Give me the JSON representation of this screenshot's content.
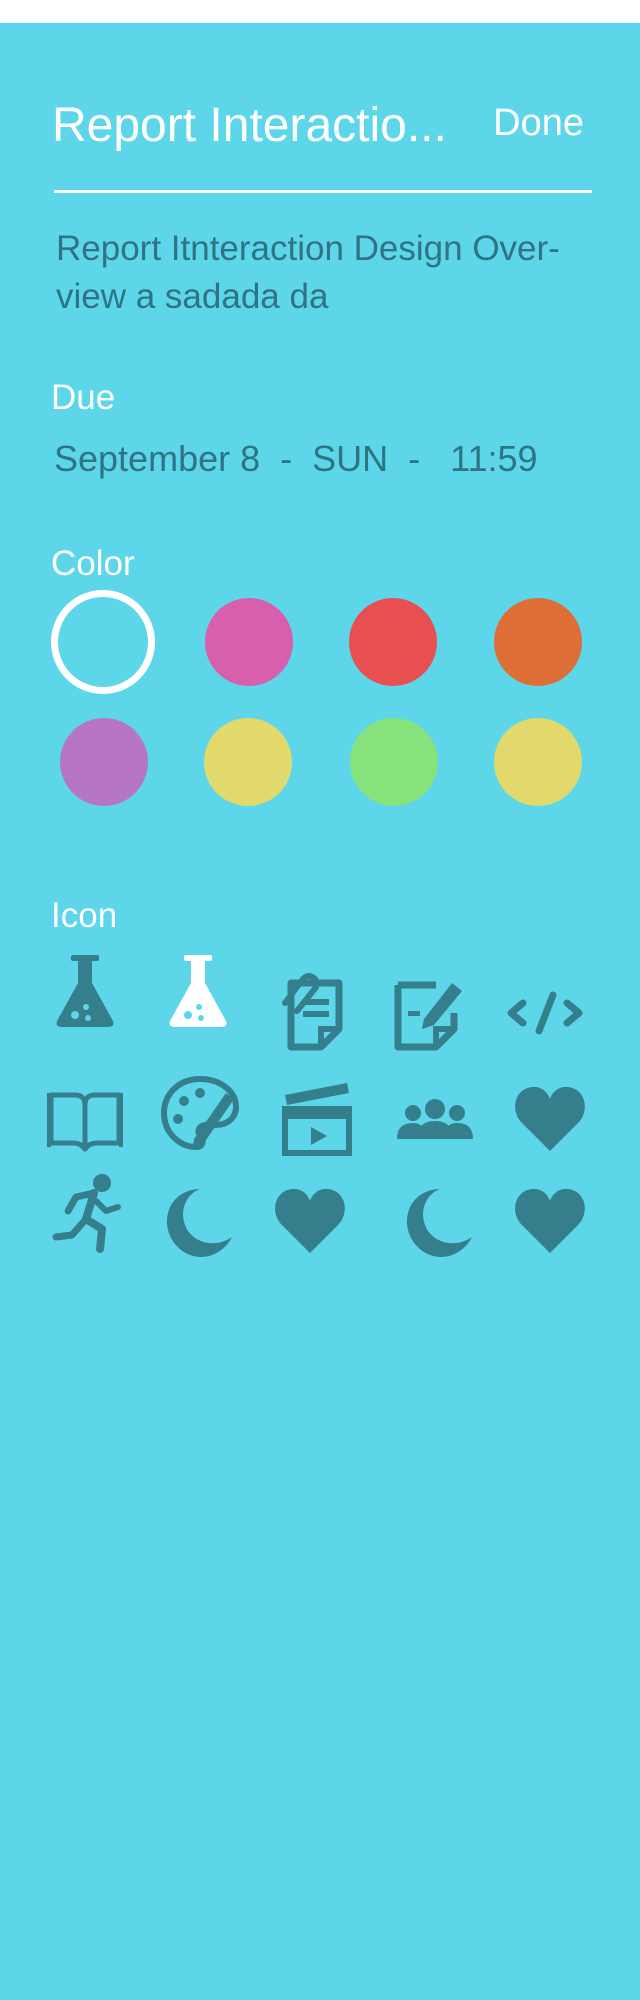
{
  "header": {
    "title": "Report Interactio...",
    "done_label": "Done"
  },
  "description": "Report Itnteraction Design Over-view a sadada  da",
  "due": {
    "label": "Due",
    "value": "September 8  -  SUN  -   11:59"
  },
  "color": {
    "label": "Color",
    "swatches": [
      {
        "name": "cyan-selected",
        "hex": "#5ed6ea",
        "selected": true
      },
      {
        "name": "pink",
        "hex": "#d85fad"
      },
      {
        "name": "red",
        "hex": "#e84f51"
      },
      {
        "name": "orange",
        "hex": "#dd6e36"
      },
      {
        "name": "purple",
        "hex": "#b775c8"
      },
      {
        "name": "yellow",
        "hex": "#e2d96d"
      },
      {
        "name": "green",
        "hex": "#86e27b"
      },
      {
        "name": "yellow-2",
        "hex": "#e2d96d"
      }
    ]
  },
  "icon": {
    "label": "Icon",
    "items": [
      "flask",
      "flask-selected",
      "clipboard-attach",
      "edit-note",
      "code",
      "open-book",
      "palette",
      "clapperboard",
      "group",
      "heart",
      "runner",
      "moon",
      "heart",
      "moon",
      "heart"
    ]
  },
  "colors": {
    "background": "#5ed6ea",
    "dark_icon": "#357f8c",
    "text_dark": "#2f7482",
    "white": "#ffffff"
  }
}
